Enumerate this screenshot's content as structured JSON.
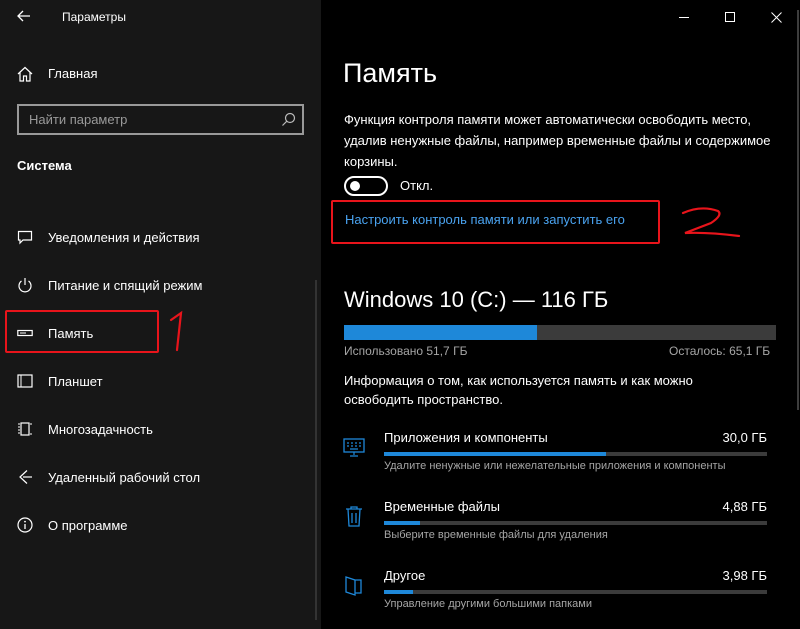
{
  "window": {
    "title": "Параметры",
    "minimize_icon": "minimize-icon",
    "maximize_icon": "maximize-icon",
    "close_icon": "close-icon"
  },
  "sidebar": {
    "home_label": "Главная",
    "search_placeholder": "Найти параметр",
    "section_title": "Система",
    "items": [
      {
        "label": "Уведомления и действия",
        "icon": "notification-icon"
      },
      {
        "label": "Питание и спящий режим",
        "icon": "power-icon"
      },
      {
        "label": "Память",
        "icon": "storage-icon",
        "selected": true
      },
      {
        "label": "Планшет",
        "icon": "tablet-icon"
      },
      {
        "label": "Многозадачность",
        "icon": "multitasking-icon"
      },
      {
        "label": "Удаленный рабочий стол",
        "icon": "remote-desktop-icon"
      },
      {
        "label": "О программе",
        "icon": "info-icon"
      }
    ]
  },
  "main": {
    "title": "Память",
    "description": "Функция контроля памяти может автоматически освободить место, удалив ненужные файлы, например временные файлы и содержимое корзины.",
    "toggle_label": "Откл.",
    "toggle_on": false,
    "configure_link": "Настроить контроль памяти или запустить его",
    "drive": {
      "title": "Windows 10 (C:) — 116 ГБ",
      "used_label": "Использовано 51,7 ГБ",
      "free_label": "Осталось: 65,1 ГБ",
      "used_fraction": 0.446
    },
    "info_text": "Информация о том, как используется память и как можно освободить пространство.",
    "categories": [
      {
        "name": "Приложения и компоненты",
        "size": "30,0 ГБ",
        "sub": "Удалите ненужные или нежелательные приложения и компоненты",
        "fraction": 0.58,
        "icon": "apps-icon"
      },
      {
        "name": "Временные файлы",
        "size": "4,88 ГБ",
        "sub": "Выберите временные файлы для удаления",
        "fraction": 0.095,
        "icon": "trash-icon"
      },
      {
        "name": "Другое",
        "size": "3,98 ГБ",
        "sub": "Управление другими большими папками",
        "fraction": 0.077,
        "icon": "folder-icon"
      }
    ]
  },
  "annotations": {
    "mark_1": "1",
    "mark_2": "2",
    "color": "#e8141b"
  },
  "colors": {
    "accent": "#1e88d9",
    "link": "#4aa3f0",
    "sidebar_bg": "#171717"
  }
}
